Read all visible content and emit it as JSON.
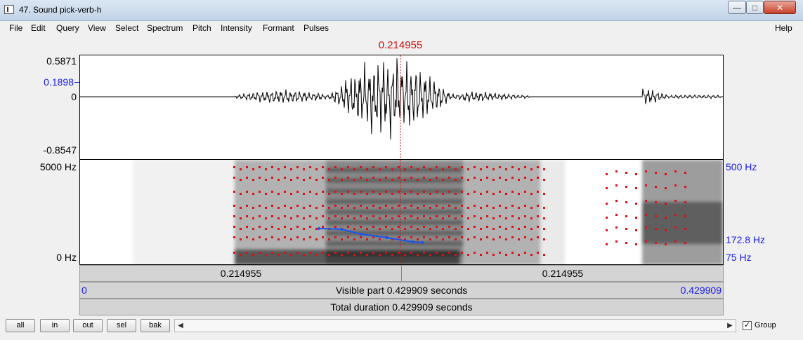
{
  "window": {
    "title": "47. Sound pick-verb-h",
    "minimize": "—",
    "maximize": "□",
    "close": "✕"
  },
  "menu": [
    "File",
    "Edit",
    "Query",
    "View",
    "Select",
    "Spectrum",
    "Pitch",
    "Intensity",
    "Formant",
    "Pulses"
  ],
  "menu_help": "Help",
  "cursor_time": "0.214955",
  "waveform": {
    "max": "0.5871",
    "cursor_value": "0.1898",
    "zero": "0",
    "min": "-0.8547"
  },
  "spectrogram": {
    "top": "5000 Hz",
    "bottom": "0 Hz",
    "pitch_top": "500 Hz",
    "pitch_value": "172.8 Hz",
    "pitch_bottom": "75 Hz"
  },
  "time_bar": {
    "left_time": "0.214955",
    "right_time": "0.214955"
  },
  "visible_bar": {
    "start": "0",
    "text": "Visible part 0.429909 seconds",
    "end": "0.429909"
  },
  "total_bar": {
    "text": "Total duration 0.429909 seconds"
  },
  "buttons": [
    "all",
    "in",
    "out",
    "sel",
    "bak"
  ],
  "scroll": {
    "left": "◀",
    "right": "▶"
  },
  "group": {
    "checked": "✓",
    "label": "Group"
  },
  "colors": {
    "cursor": "#cc1111",
    "pitch_line": "#1a55ee",
    "formant_dot": "#dd1111",
    "axis_blue": "#1a1aee"
  }
}
